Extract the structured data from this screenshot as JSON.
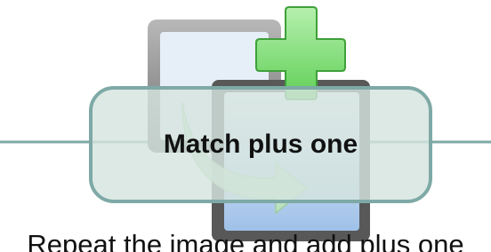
{
  "title": "Match plus one",
  "subtitle_partial": "Repeat the image and add plus one",
  "icons": {
    "back_card": "gray-frame-icon",
    "front_card": "blue-frame-icon",
    "plus": "green-plus-icon",
    "arrow": "curved-arrow-icon"
  },
  "colors": {
    "line": "#7ea9a6",
    "banner_fill": "#d5e4df",
    "banner_border": "#7ea9a6",
    "plus_fill": "#7ee07a",
    "plus_border": "#3fa03a",
    "frame_gray": "#8a8a8a",
    "card_blue": "#a9c8ea"
  }
}
